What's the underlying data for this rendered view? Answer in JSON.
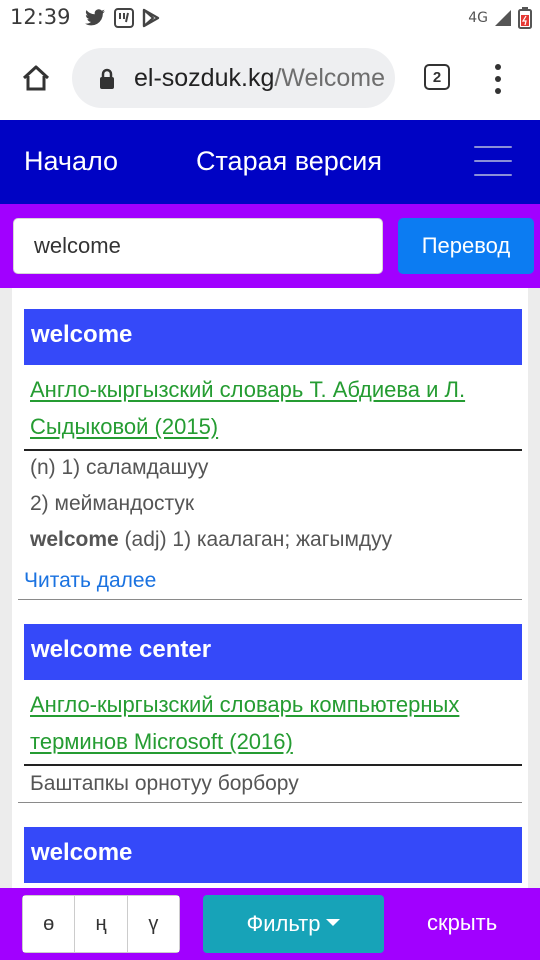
{
  "status_bar": {
    "time": "12:39",
    "network": "4G",
    "left_icons": [
      "twitter-icon",
      "notification-icon",
      "play-store-icon"
    ]
  },
  "browser": {
    "url_domain": "el-sozduk.kg",
    "url_path": "/Welcome",
    "tab_count": "2"
  },
  "nav": {
    "home": "Начало",
    "old_version": "Старая версия"
  },
  "search": {
    "value": "welcome",
    "button": "Перевод"
  },
  "entries": [
    {
      "title": "welcome",
      "source": "Англо-кыргызский словарь Т. Абдиева и Л. Сыдыковой (2015)",
      "lines": [
        {
          "bold": "",
          "text": "(n) 1) саламдашуу"
        },
        {
          "bold": "",
          "text": "2) меймандостук"
        },
        {
          "bold": "welcome",
          "text": " (adj) 1) каалаган; жагымдуу"
        }
      ],
      "read_more": "Читать далее"
    },
    {
      "title": "welcome center",
      "source": "Англо-кыргызский словарь компьютерных терминов Microsoft (2016)",
      "lines": [
        {
          "bold": "",
          "text": "Баштапкы орнотуу борбору"
        }
      ]
    },
    {
      "title": "welcome"
    }
  ],
  "bottom_bar": {
    "keys": [
      "ө",
      "ң",
      "ү"
    ],
    "filter": "Фильтр",
    "hide": "скрыть"
  },
  "colors": {
    "nav_bg": "#0003c4",
    "search_band_bg": "#a100ff",
    "entry_title_bg": "#3549f9",
    "translate_btn": "#0c7cf2",
    "filter_btn": "#17a3b8",
    "source_link": "#259c32",
    "read_more_link": "#1a72e0"
  }
}
